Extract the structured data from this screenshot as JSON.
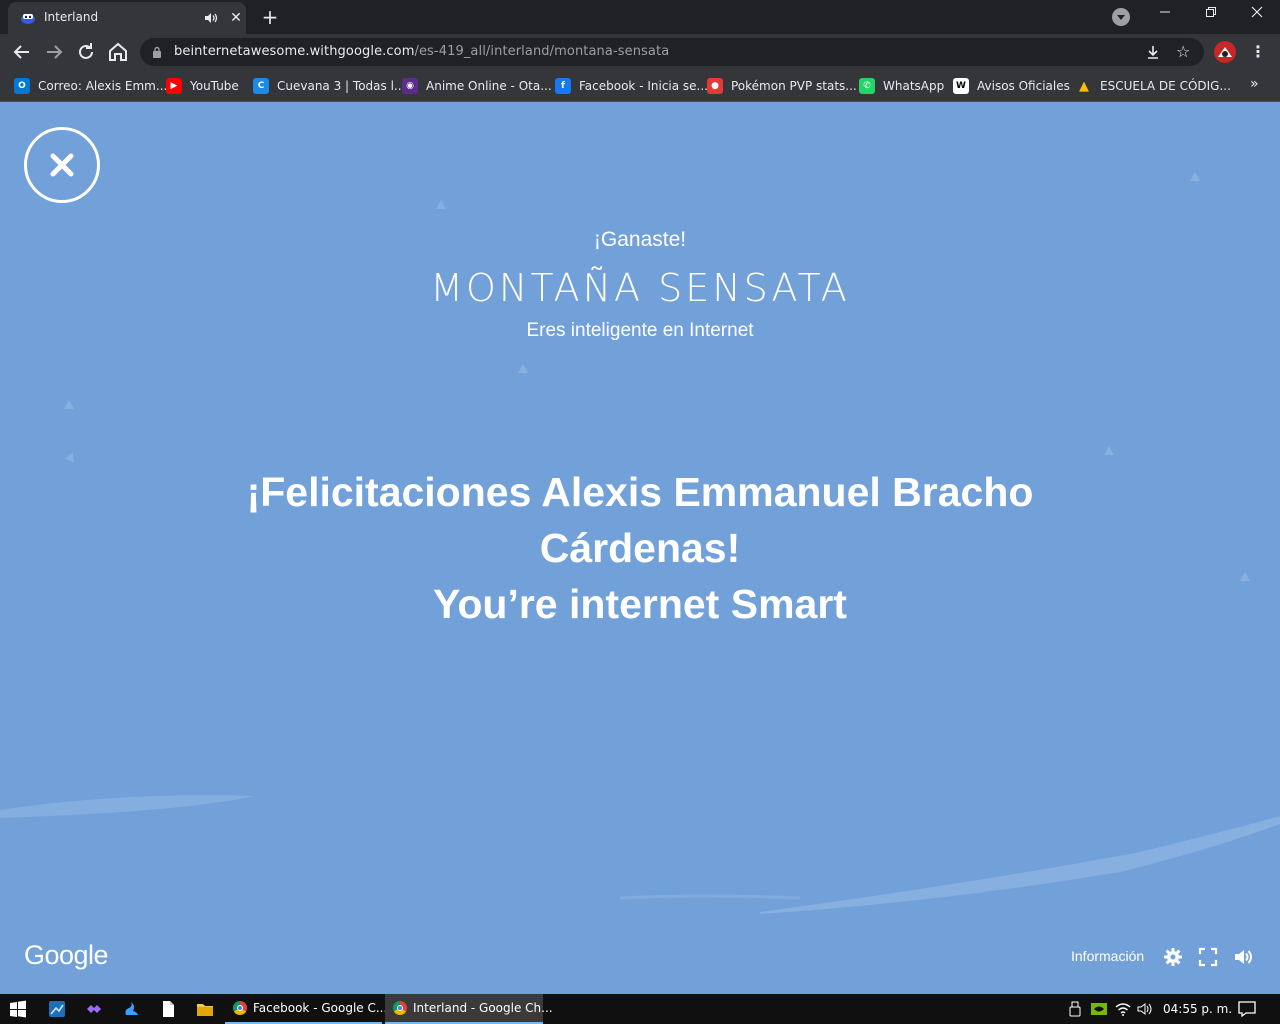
{
  "browser": {
    "tab": {
      "title": "Interland"
    },
    "new_tab_symbol": "+",
    "omnibox": {
      "host": "beinternetawesome.withgoogle.com",
      "path": "/es-419_all/interland/montana-sensata"
    },
    "icons": [
      "back-icon",
      "forward-icon",
      "reload-icon",
      "home-icon",
      "lock-icon",
      "download-icon",
      "star-icon",
      "menu-icon"
    ],
    "bookmarks": [
      {
        "label": "Correo: Alexis Emm...",
        "icon": "outlook-icon",
        "color": "#0078d4"
      },
      {
        "label": "YouTube",
        "icon": "youtube-icon",
        "color": "#ff0000"
      },
      {
        "label": "Cuevana 3 | Todas l...",
        "icon": "cuevana-icon",
        "color": "#1e88e5"
      },
      {
        "label": "Anime Online - Ota...",
        "icon": "otaku-icon",
        "color": "#5b2c8a"
      },
      {
        "label": "Facebook - Inicia se...",
        "icon": "facebook-icon",
        "color": "#1877f2"
      },
      {
        "label": "Pokémon PVP stats...",
        "icon": "pokeball-icon",
        "color": "#e53935"
      },
      {
        "label": "WhatsApp",
        "icon": "whatsapp-icon",
        "color": "#25d366"
      },
      {
        "label": "Avisos Oficiales",
        "icon": "wix-icon",
        "color": "#ffffff"
      },
      {
        "label": "ESCUELA DE CÓDIG...",
        "icon": "drive-icon",
        "color": "#fbbc04"
      }
    ],
    "bookmarks_more": "»"
  },
  "page": {
    "background": "#72a0d8",
    "win_label": "¡Ganaste!",
    "world_title": "MONTAÑA SENSATA",
    "subtitle": "Eres inteligente en Internet",
    "congrats_line1": "¡Felicitaciones Alexis Emmanuel Bracho",
    "congrats_line2": "Cárdenas!",
    "congrats_line3": "You’re internet Smart",
    "google_logo": "Google",
    "info_label": "Información"
  },
  "taskbar": {
    "apps": [
      {
        "label": "Facebook - Google C..."
      },
      {
        "label": "Interland - Google Ch..."
      }
    ],
    "clock": "04:55 p. m."
  }
}
